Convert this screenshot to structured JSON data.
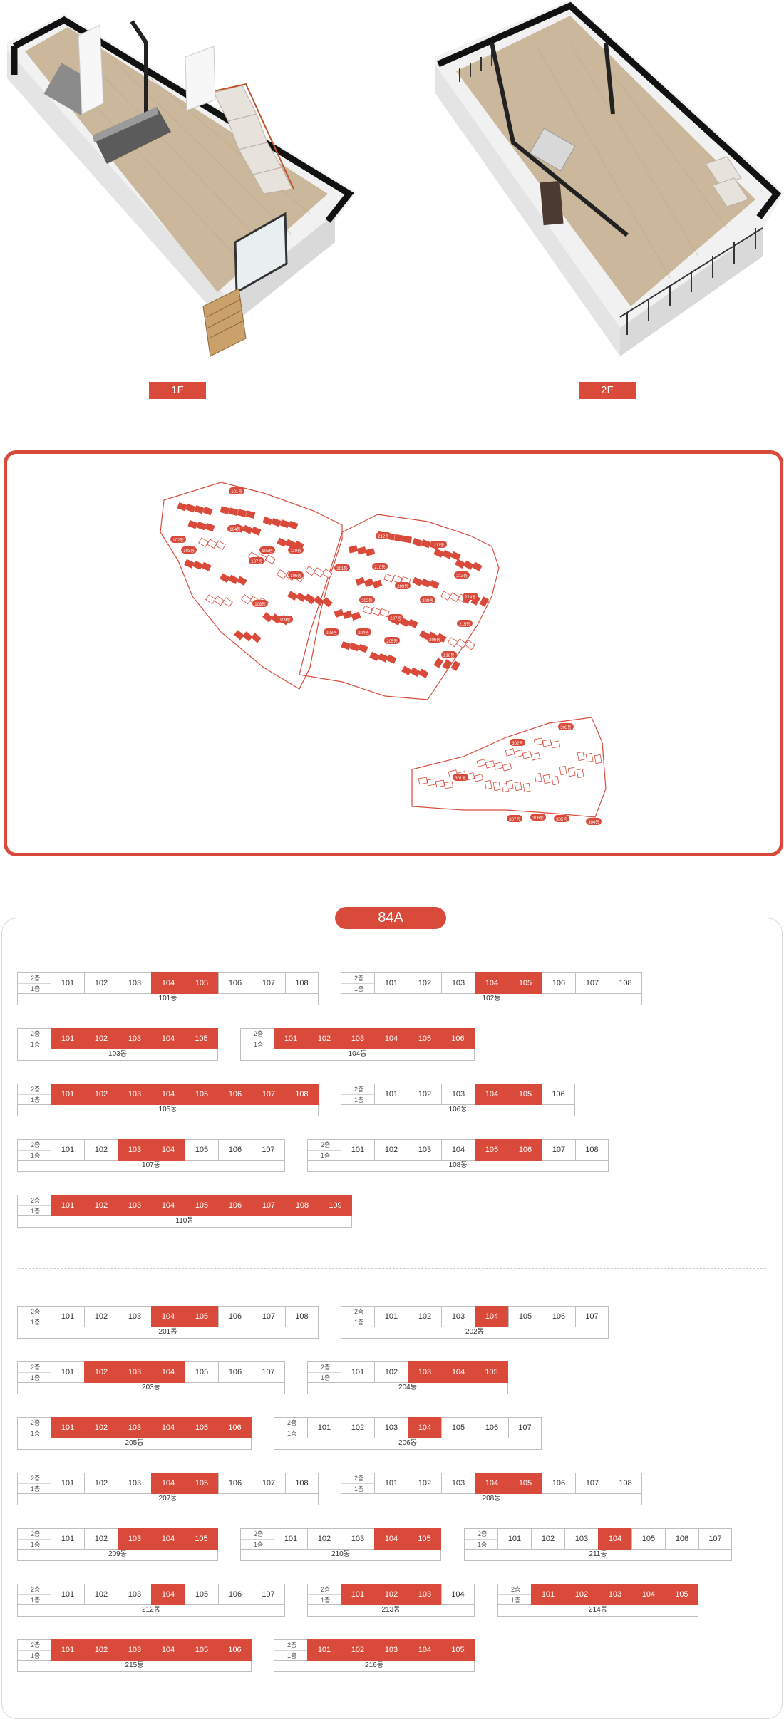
{
  "floorplans": {
    "first_floor_label": "1F",
    "second_floor_label": "2F"
  },
  "colors": {
    "accent": "#d94a3a",
    "border": "#bfbfbf",
    "wood_floor": "#cbb79c"
  },
  "sitemap": {
    "zone_a_labels": [
      "101동",
      "102동",
      "103동",
      "104동",
      "105동",
      "106동",
      "107동",
      "108동",
      "109동",
      "110동"
    ],
    "zone_b_labels": [
      "201동",
      "202동",
      "203동",
      "204동",
      "205동",
      "206동",
      "207동",
      "208동",
      "209동",
      "210동",
      "211동",
      "212동",
      "213동",
      "214동",
      "215동",
      "216동"
    ],
    "zone_c_labels": [
      "301동",
      "302동",
      "303동",
      "304동",
      "305동",
      "306동",
      "307동"
    ]
  },
  "unit_table": {
    "type_label": "84A",
    "floor_labels": {
      "upper": "2층",
      "lower": "1층"
    },
    "buildings": [
      {
        "name": "101동",
        "units": [
          "101",
          "102",
          "103",
          "104",
          "105",
          "106",
          "107",
          "108"
        ],
        "selected": [
          "104",
          "105"
        ]
      },
      {
        "name": "102동",
        "units": [
          "101",
          "102",
          "103",
          "104",
          "105",
          "106",
          "107",
          "108"
        ],
        "selected": [
          "104",
          "105"
        ]
      },
      {
        "name": "103동",
        "units": [
          "101",
          "102",
          "103",
          "104",
          "105"
        ],
        "selected": [
          "101",
          "102",
          "103",
          "104",
          "105"
        ]
      },
      {
        "name": "104동",
        "units": [
          "101",
          "102",
          "103",
          "104",
          "105",
          "106"
        ],
        "selected": [
          "101",
          "102",
          "103",
          "104",
          "105",
          "106"
        ]
      },
      {
        "name": "105동",
        "units": [
          "101",
          "102",
          "103",
          "104",
          "105",
          "106",
          "107",
          "108"
        ],
        "selected": [
          "101",
          "102",
          "103",
          "104",
          "105",
          "106",
          "107",
          "108"
        ]
      },
      {
        "name": "106동",
        "units": [
          "101",
          "102",
          "103",
          "104",
          "105",
          "106"
        ],
        "selected": [
          "104",
          "105"
        ]
      },
      {
        "name": "107동",
        "units": [
          "101",
          "102",
          "103",
          "104",
          "105",
          "106",
          "107"
        ],
        "selected": [
          "103",
          "104"
        ]
      },
      {
        "name": "108동",
        "units": [
          "101",
          "102",
          "103",
          "104",
          "105",
          "106",
          "107",
          "108"
        ],
        "selected": [
          "105",
          "106"
        ]
      },
      {
        "name": "110동",
        "units": [
          "101",
          "102",
          "103",
          "104",
          "105",
          "106",
          "107",
          "108",
          "109"
        ],
        "selected": [
          "101",
          "102",
          "103",
          "104",
          "105",
          "106",
          "107",
          "108",
          "109"
        ]
      },
      {
        "name": "201동",
        "units": [
          "101",
          "102",
          "103",
          "104",
          "105",
          "106",
          "107",
          "108"
        ],
        "selected": [
          "104",
          "105"
        ]
      },
      {
        "name": "202동",
        "units": [
          "101",
          "102",
          "103",
          "104",
          "105",
          "106",
          "107"
        ],
        "selected": [
          "104"
        ]
      },
      {
        "name": "203동",
        "units": [
          "101",
          "102",
          "103",
          "104",
          "105",
          "106",
          "107"
        ],
        "selected": [
          "102",
          "103",
          "104"
        ]
      },
      {
        "name": "204동",
        "units": [
          "101",
          "102",
          "103",
          "104",
          "105"
        ],
        "selected": [
          "103",
          "104",
          "105"
        ]
      },
      {
        "name": "205동",
        "units": [
          "101",
          "102",
          "103",
          "104",
          "105",
          "106"
        ],
        "selected": [
          "101",
          "102",
          "103",
          "104",
          "105",
          "106"
        ]
      },
      {
        "name": "206동",
        "units": [
          "101",
          "102",
          "103",
          "104",
          "105",
          "106",
          "107"
        ],
        "selected": [
          "104"
        ]
      },
      {
        "name": "207동",
        "units": [
          "101",
          "102",
          "103",
          "104",
          "105",
          "106",
          "107",
          "108"
        ],
        "selected": [
          "104",
          "105"
        ]
      },
      {
        "name": "208동",
        "units": [
          "101",
          "102",
          "103",
          "104",
          "105",
          "106",
          "107",
          "108"
        ],
        "selected": [
          "104",
          "105"
        ]
      },
      {
        "name": "209동",
        "units": [
          "101",
          "102",
          "103",
          "104",
          "105"
        ],
        "selected": [
          "103",
          "104",
          "105"
        ]
      },
      {
        "name": "210동",
        "units": [
          "101",
          "102",
          "103",
          "104",
          "105"
        ],
        "selected": [
          "104",
          "105"
        ]
      },
      {
        "name": "211동",
        "units": [
          "101",
          "102",
          "103",
          "104",
          "105",
          "106",
          "107"
        ],
        "selected": [
          "104"
        ]
      },
      {
        "name": "212동",
        "units": [
          "101",
          "102",
          "103",
          "104",
          "105",
          "106",
          "107"
        ],
        "selected": [
          "104"
        ]
      },
      {
        "name": "213동",
        "units": [
          "101",
          "102",
          "103",
          "104"
        ],
        "selected": [
          "101",
          "102",
          "103"
        ]
      },
      {
        "name": "214동",
        "units": [
          "101",
          "102",
          "103",
          "104",
          "105"
        ],
        "selected": [
          "101",
          "102",
          "103",
          "104",
          "105"
        ]
      },
      {
        "name": "215동",
        "units": [
          "101",
          "102",
          "103",
          "104",
          "105",
          "106"
        ],
        "selected": [
          "101",
          "102",
          "103",
          "104",
          "105",
          "106"
        ]
      },
      {
        "name": "216동",
        "units": [
          "101",
          "102",
          "103",
          "104",
          "105"
        ],
        "selected": [
          "101",
          "102",
          "103",
          "104",
          "105"
        ]
      }
    ]
  }
}
